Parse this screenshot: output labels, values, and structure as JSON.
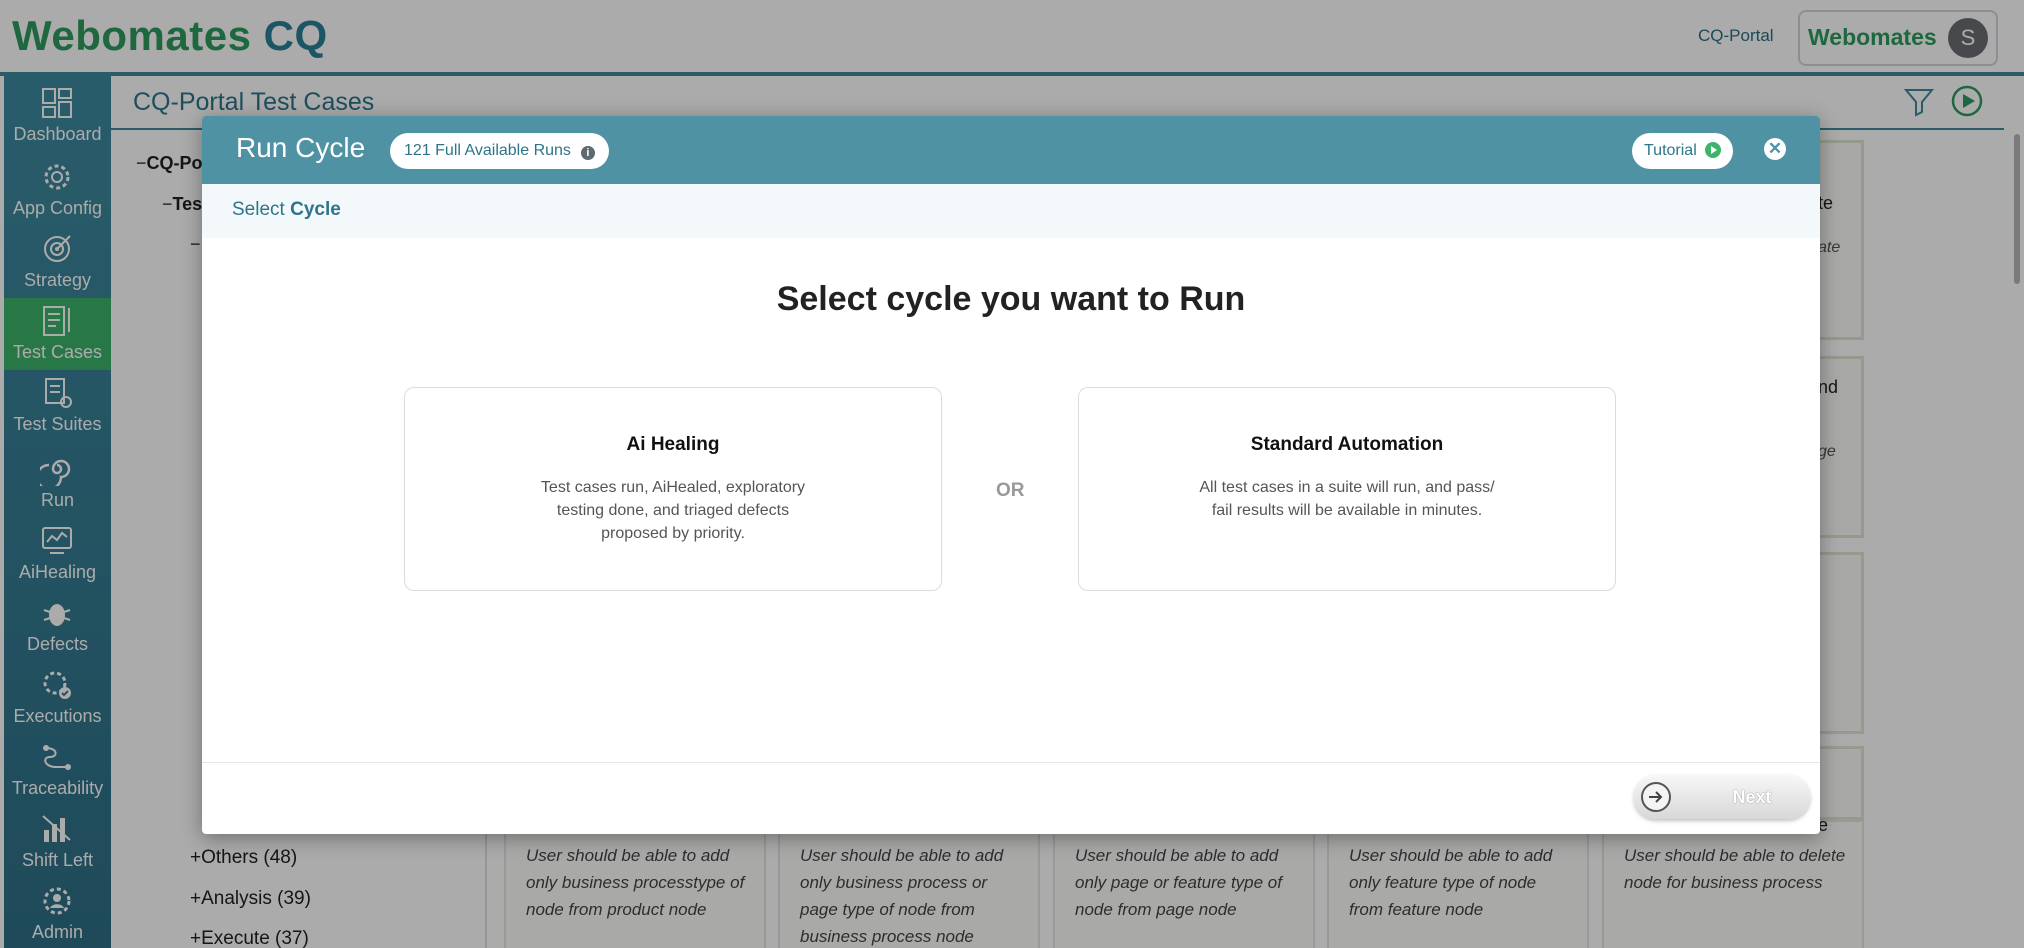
{
  "header": {
    "logo_main": "Webomates",
    "logo_suffix": "CQ",
    "portal_link": "CQ-Portal",
    "user_brand": "Webomates",
    "avatar_initial": "S"
  },
  "sidebar": {
    "items": [
      {
        "label": "Dashboard",
        "icon": "dashboard-icon"
      },
      {
        "label": "App Config",
        "icon": "gear-icon"
      },
      {
        "label": "Strategy",
        "icon": "target-icon"
      },
      {
        "label": "Test Cases",
        "icon": "test-cases-icon"
      },
      {
        "label": "Test Suites",
        "icon": "test-suites-icon"
      },
      {
        "label": "Run",
        "icon": "spiral-icon"
      },
      {
        "label": "AiHealing",
        "icon": "ai-healing-icon"
      },
      {
        "label": "Defects",
        "icon": "bug-icon"
      },
      {
        "label": "Executions",
        "icon": "executions-icon"
      },
      {
        "label": "Traceability",
        "icon": "traceability-icon"
      },
      {
        "label": "Shift Left",
        "icon": "shift-left-icon"
      },
      {
        "label": "Admin",
        "icon": "admin-icon"
      }
    ],
    "active_index": 3
  },
  "main": {
    "title": "CQ-Portal Test Cases",
    "tree": {
      "root_prefix": "−",
      "root_label": "CQ-Po",
      "child_prefix": "−",
      "child_label": "Tes",
      "grandchild_prefix": "−",
      "categories": [
        {
          "prefix": "+",
          "label": "Others (48)"
        },
        {
          "prefix": "+",
          "label": "Analysis (39)"
        },
        {
          "prefix": "+",
          "label": "Execute (37)"
        }
      ]
    },
    "cards": [
      {
        "text": "User should be able to add only business processtype of node from product node"
      },
      {
        "text": "User should be able to add only business process or page type of node from business process node"
      },
      {
        "text": "User should be able to add only page or feature type of node from page node"
      },
      {
        "text": "User should be able to add only feature type of node from feature node"
      },
      {
        "text": "User should be able to delete node for business process"
      }
    ],
    "right_fragments": {
      "c1_title": "te",
      "c1_sub": "ate",
      "c2_title": "nd",
      "c2_sub": "ge",
      "c5_title": "e"
    }
  },
  "modal": {
    "title": "Run Cycle",
    "runs_badge": "121 Full Available Runs",
    "info_glyph": "i",
    "tutorial_label": "Tutorial",
    "close_glyph": "✕",
    "step_prefix": "Select",
    "step_name": "Cycle",
    "heading": "Select cycle you want to Run",
    "or_label": "OR",
    "choices": [
      {
        "title": "Ai Healing",
        "description": "Test cases run, AiHealed, exploratory\ntesting done, and triaged defects\nproposed by priority."
      },
      {
        "title": "Standard Automation",
        "description": "All test cases in a suite will run, and pass/\nfail results will be available in minutes."
      }
    ],
    "next_label": "Next"
  },
  "colors": {
    "brand_green": "#2e9a5f",
    "brand_teal": "#2a7f95",
    "modal_header": "#4e92a3",
    "sidebar_active": "#3db36b"
  }
}
